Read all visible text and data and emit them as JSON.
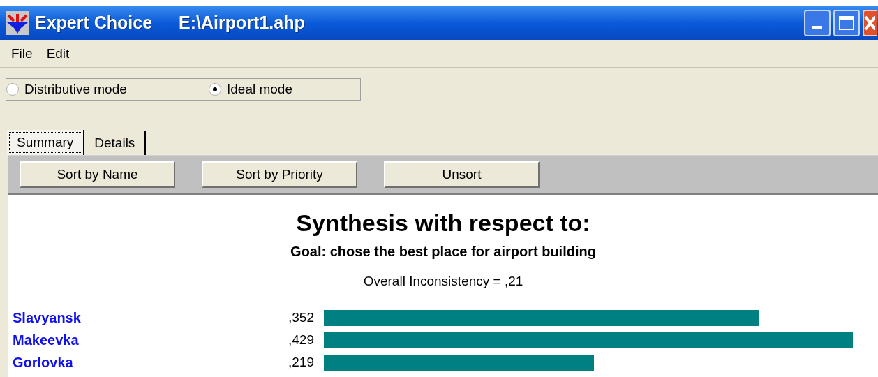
{
  "window": {
    "app_name": "Expert Choice",
    "file_path": "E:\\Airport1.ahp"
  },
  "menu": [
    "File",
    "Edit"
  ],
  "modes": [
    {
      "label": "Distributive mode",
      "selected": false
    },
    {
      "label": "Ideal mode",
      "selected": true
    }
  ],
  "tabs": [
    {
      "label": "Summary",
      "selected": true
    },
    {
      "label": "Details",
      "selected": false
    }
  ],
  "toolbar": [
    "Sort by Name",
    "Sort by Priority",
    "Unsort"
  ],
  "synthesis": {
    "title": "Synthesis with respect to:",
    "goal": "Goal: chose the best place for airport building",
    "inconsistency": "Overall Inconsistency = ,21"
  },
  "alternatives": [
    {
      "name": "Slavyansk",
      "value": ",352",
      "level": 0.81
    },
    {
      "name": "Makeevka",
      "value": ",429",
      "level": 0.985
    },
    {
      "name": "Gorlovka",
      "value": ",219",
      "level": 0.502
    }
  ]
}
